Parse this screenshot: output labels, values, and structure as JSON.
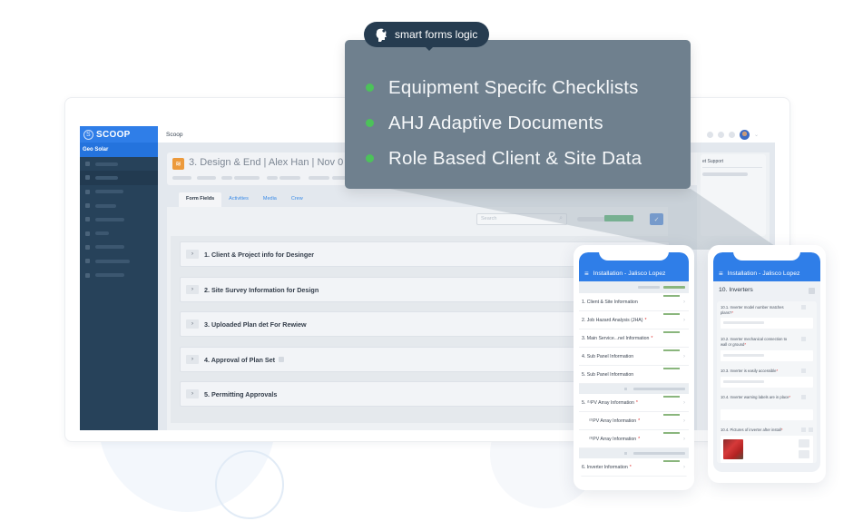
{
  "tooltip": {
    "badge_label": "smart forms logic",
    "badge_icon": "brain-gear-icon",
    "features": [
      "Equipment Specifc Checklists",
      "AHJ Adaptive Documents",
      "Role Based Client & Site Data"
    ],
    "accent_color": "#4cc25a"
  },
  "app": {
    "brand": "SCOOP",
    "window_title": "Scoop",
    "org_name": "Geo Solar",
    "header_title": "3. Design & End | Alex Han | Nov 0",
    "tabs": [
      "Form Fields",
      "Activities",
      "Media",
      "Crew"
    ],
    "active_tab": "Form Fields",
    "search_placeholder": "Search",
    "right_panel_title": "et Support",
    "sections": [
      "1. Client & Project info for Desinger",
      "2. Site Survey Information for Design",
      "3. Uploaded Plan det For Rewiew",
      "4. Approval of Plan Set",
      "5. Permitting Approvals"
    ],
    "colors": {
      "brand_blue": "#2f7ee8",
      "sidebar": "#27425a",
      "progress_green": "#2da150"
    }
  },
  "phone1": {
    "title": "Installation - Jalisco Lopez",
    "rows": [
      {
        "label": "1. Client & Site Information",
        "required": false,
        "arrow": true
      },
      {
        "label": "2. Job Hazard Analysis (JHA)",
        "required": true,
        "arrow": true
      },
      {
        "label": "3. Main Service...nel Information",
        "required": true,
        "arrow": false
      },
      {
        "label": "4. Sub Panel Information",
        "required": false,
        "arrow": true
      },
      {
        "label": "5. Sub Panel Information",
        "required": false,
        "arrow": false
      }
    ],
    "rows2": [
      {
        "label": "5. ⁽¹⁾PV Array Information",
        "required": true,
        "indent": false
      },
      {
        "label": "⁽²⁾PV Array Information",
        "required": true,
        "indent": true
      },
      {
        "label": "⁽³⁾PV Array Information",
        "required": true,
        "indent": true
      }
    ],
    "rows3": [
      {
        "label": "6. Inverter Information",
        "required": true
      }
    ],
    "required_mark": "*"
  },
  "phone2": {
    "title": "Installation - Jalisco Lopez",
    "section_title": "10. Inverters",
    "questions": [
      "10.1. Inverter model number matches plans?",
      "10.2. Inverter mechanical connection to wall or ground",
      "10.3. Inverter is easily accessible",
      "10.4. Inverter warning labels are in place",
      "10.4. Pictures of inverter after install"
    ],
    "required_mark": "*"
  }
}
